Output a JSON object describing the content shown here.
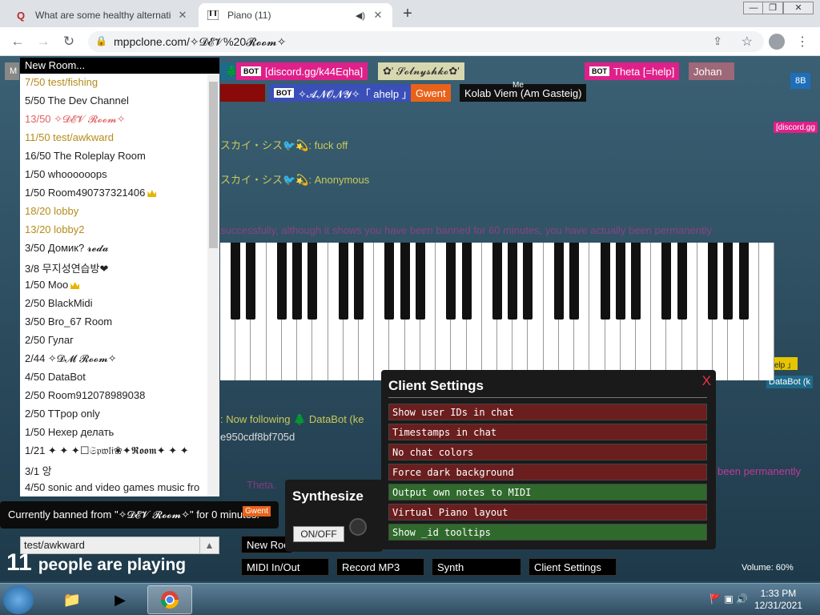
{
  "browser": {
    "tabs": [
      {
        "title": "What are some healthy alternati",
        "favicon": "Q",
        "active": false
      },
      {
        "title": "Piano (11)",
        "favicon": "piano-icon",
        "active": true
      }
    ],
    "url": "mppclone.com/✧𝓓𝓔𝓥%20𝓡𝓸𝓸𝓶✧"
  },
  "users": {
    "row1": [
      {
        "label": "[discord.gg/k44Eqha]",
        "bot": true,
        "color": "#e0208a"
      },
      {
        "label": "✿' 𝓢𝓸𝓵𝓷𝔂𝓼𝓱𝓴𝓸✿'",
        "bot": false,
        "color": "#dcdcb4"
      },
      {
        "label": "Theta [=help]",
        "bot": true,
        "color": "#e0208a"
      },
      {
        "label": "Johan",
        "bot": false,
        "color": "#a06a7a"
      }
    ],
    "row2": [
      {
        "label": "",
        "bot": false,
        "color": "#8a0a0a"
      },
      {
        "label": "✧𝓐𝓝𝓞𝓝𝓨✧「 ahelp 」",
        "bot": true,
        "color": "#3a4fb8"
      },
      {
        "label": "Gwent",
        "bot": false,
        "color": "#e8621a"
      },
      {
        "label": "Kolab Viem (Am Gasteig)",
        "bot": false,
        "color": "#101010"
      }
    ],
    "me_label": "Me",
    "extra_right": "[discord.gg",
    "extra_right2": "「 ahelp 」",
    "databot": "DataBot (k",
    "badge_8b": "8B",
    "m_label": "M"
  },
  "chat": {
    "lines": [
      {
        "text": "スカイ・シス🐦💫: fuck off",
        "color": "#c9c95a"
      },
      {
        "text": "スカイ・シス🐦💫: Anonymous",
        "color": "#c9c95a"
      },
      {
        "text": "successfully, although it shows you have been banned for 60 minutes, you have actually been permanently",
        "color": "#c2389a"
      },
      {
        "text": ": Now following 🌲 DataBot (ke",
        "color": "#c9c95a"
      },
      {
        "text": "e950cdf8bf705d",
        "color": "#dddddd"
      },
      {
        "text": "been permanently",
        "color": "#c2389a"
      },
      {
        "text": "Theta.",
        "color": "#c2389a"
      }
    ]
  },
  "roomlist": {
    "header": "New Room...",
    "rooms": [
      {
        "label": "7/50 test/fishing",
        "type": "full"
      },
      {
        "label": "5/50 The Dev Channel",
        "type": "normal"
      },
      {
        "label": "13/50 ✧𝓓𝓔𝓥 𝓡𝓸𝓸𝓶✧",
        "type": "mine"
      },
      {
        "label": "11/50 test/awkward",
        "type": "full"
      },
      {
        "label": "16/50 The Roleplay Room",
        "type": "normal"
      },
      {
        "label": "1/50 whoooooops",
        "type": "normal"
      },
      {
        "label": "1/50 Room490737321406",
        "type": "crown"
      },
      {
        "label": "18/20 lobby",
        "type": "full"
      },
      {
        "label": "13/20 lobby2",
        "type": "full"
      },
      {
        "label": "3/50 Домик? 𝓻𝓮𝓭𝓪",
        "type": "normal"
      },
      {
        "label": "3/8 무지성연습방❤",
        "type": "normal"
      },
      {
        "label": "1/50 Moo",
        "type": "crown"
      },
      {
        "label": "2/50 BlackMidi",
        "type": "normal"
      },
      {
        "label": "3/50 Bro_67 Room",
        "type": "normal"
      },
      {
        "label": "2/50 Гулаг",
        "type": "normal"
      },
      {
        "label": "2/44 ✧𝓓𝓜 𝓡𝓸𝓸𝓶✧",
        "type": "normal"
      },
      {
        "label": "4/50 DataBot",
        "type": "normal"
      },
      {
        "label": "2/50 Room912078989038",
        "type": "normal"
      },
      {
        "label": "2/50 TTpop only",
        "type": "normal"
      },
      {
        "label": "1/50 Нехер делать",
        "type": "normal"
      },
      {
        "label": "1/21 ✦ ✦ ✦☐𝔖𝔭𝔴𝔩𝔦❀✦𝕽𝖔𝖔𝖒✦ ✦ ✦",
        "type": "normal"
      },
      {
        "label": "3/1 앙",
        "type": "normal"
      },
      {
        "label": "4/50 sonic and video games music fro",
        "type": "normal"
      }
    ],
    "input_value": "test/awkward"
  },
  "ban_tooltip": "Currently banned from \"✧𝓓𝓔𝓥 𝓡𝓸𝓸𝓶✧\" for 0 minutes.",
  "ban_gwent": "Gwent",
  "players": {
    "count": "11",
    "label": "people are playing"
  },
  "settings": {
    "title": "Client Settings",
    "close": "X",
    "options": [
      {
        "label": "Show user IDs in chat",
        "on": false
      },
      {
        "label": "Timestamps in chat",
        "on": false
      },
      {
        "label": "No chat colors",
        "on": false
      },
      {
        "label": "Force dark background",
        "on": false
      },
      {
        "label": "Output own notes to MIDI",
        "on": true
      },
      {
        "label": "Virtual Piano layout",
        "on": false
      },
      {
        "label": "Show _id tooltips",
        "on": true
      }
    ]
  },
  "synth": {
    "title": "Synthesize",
    "onoff": "ON/OFF"
  },
  "bottom_buttons": {
    "new_room": "New Roo",
    "midi": "MIDI In/Out",
    "record": "Record MP3",
    "synth": "Synth",
    "client_settings": "Client Settings",
    "s_partial": "s"
  },
  "volume": "Volume: 60%",
  "taskbar": {
    "time": "1:33 PM",
    "date": "12/31/2021"
  }
}
